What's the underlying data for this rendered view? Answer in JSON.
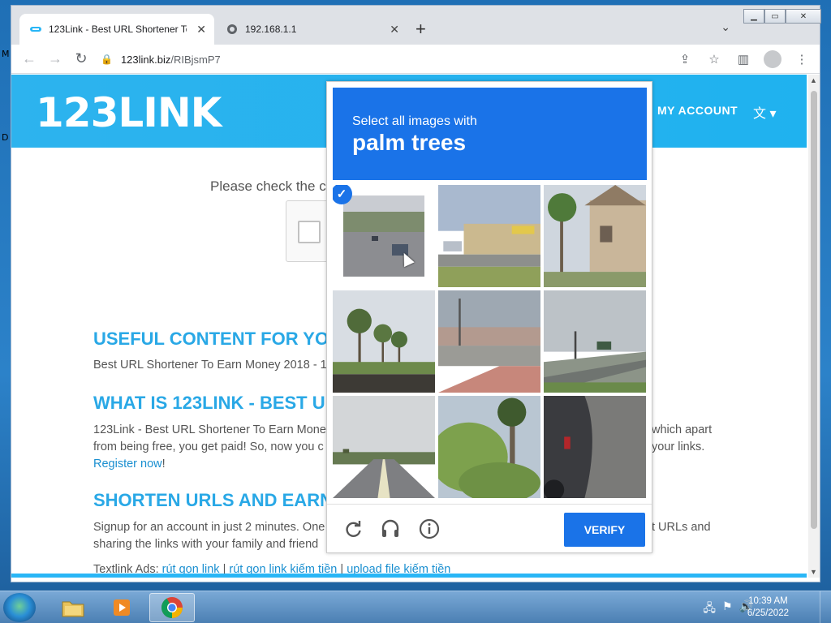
{
  "desktop": {
    "left_labels": [
      "M",
      "D"
    ]
  },
  "browser": {
    "tabs": [
      {
        "title": "123Link - Best URL Shortener To",
        "active": true,
        "icon": "link-favicon"
      },
      {
        "title": "192.168.1.1",
        "active": false,
        "icon": "globe-icon"
      }
    ],
    "new_tab": "+",
    "url_host": "123link.biz",
    "url_path": "/RIBjsmP7"
  },
  "site": {
    "logo": "123LINK",
    "my_account": "MY ACCOUNT",
    "captcha_note": "Please check the ca",
    "sections": [
      {
        "heading": "USEFUL CONTENT FOR YO",
        "lines": [
          "Best URL Shortener To Earn Money 2018 - 1"
        ]
      },
      {
        "heading": "WHAT IS 123LINK - BEST U",
        "lines": [
          "123Link - Best URL Shortener To Earn Mone",
          "from being free, you get paid! So, now you c"
        ],
        "link": "Register now",
        "link_suffix": "!",
        "right_lines": [
          "which apart",
          "your links."
        ]
      },
      {
        "heading": "SHORTEN URLS AND EARN",
        "lines": [
          "Signup for an account in just 2 minutes. One",
          "sharing the links with your family and friend"
        ],
        "right_lines": [
          "t URLs and"
        ]
      }
    ],
    "textlink": {
      "label": "Textlink Ads: ",
      "links": [
        "rút gọn link",
        "rút gọn link kiếm tiền",
        "upload file kiếm tiền"
      ],
      "sep": " | "
    }
  },
  "challenge": {
    "prompt_line1": "Select all images with",
    "prompt_line2": "palm trees",
    "verify_label": "VERIFY",
    "tiles": [
      {
        "scene": "road-traffic",
        "selected": true
      },
      {
        "scene": "dollar-store-lot",
        "selected": false
      },
      {
        "scene": "house-with-palms",
        "selected": false
      },
      {
        "scene": "palm-trees-field",
        "selected": false
      },
      {
        "scene": "street-plaza",
        "selected": false
      },
      {
        "scene": "highway-overcast",
        "selected": false
      },
      {
        "scene": "highway-road",
        "selected": false
      },
      {
        "scene": "palm-trees-bushes",
        "selected": false
      },
      {
        "scene": "car-closeup",
        "selected": false
      }
    ],
    "footer_icons": [
      "reload-icon",
      "audio-icon",
      "info-icon"
    ]
  },
  "taskbar": {
    "apps": [
      "folder-icon",
      "media-player-icon",
      "chrome-icon"
    ],
    "time": "10:39 AM",
    "date": "6/25/2022"
  },
  "colors": {
    "accent": "#1a73e8",
    "brand": "#29b6f6",
    "heading": "#29a8e6"
  }
}
